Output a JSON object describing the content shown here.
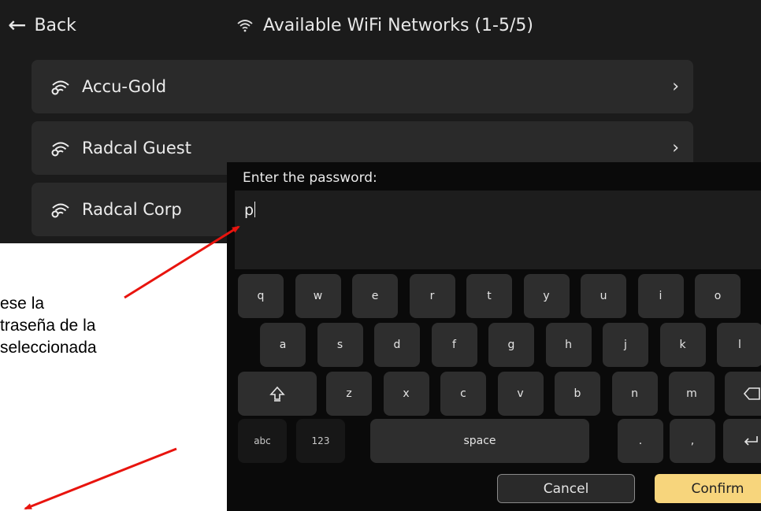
{
  "header": {
    "back_label": "Back",
    "title": "Available WiFi Networks (1-5/5)"
  },
  "networks": [
    {
      "name": "Accu-Gold"
    },
    {
      "name": "Radcal Guest"
    },
    {
      "name": "Radcal Corp"
    }
  ],
  "annotation": {
    "lines": [
      "ese la",
      "traseña de la",
      "seleccionada"
    ],
    "arrow_color": "#e8140e"
  },
  "password_dialog": {
    "prompt": "Enter the password:",
    "value": "p",
    "cancel_label": "Cancel",
    "confirm_label": "Confirm"
  },
  "keyboard": {
    "row1": [
      "q",
      "w",
      "e",
      "r",
      "t",
      "y",
      "u",
      "i",
      "o"
    ],
    "row2": [
      "a",
      "s",
      "d",
      "f",
      "g",
      "h",
      "j",
      "k",
      "l"
    ],
    "row3": [
      "z",
      "x",
      "c",
      "v",
      "b",
      "n",
      "m"
    ],
    "abc_label": "abc",
    "num_label": "123",
    "space_label": "space",
    "period_label": ".",
    "comma_label": ","
  },
  "colors": {
    "panel_bg": "#1b1b1b",
    "item_bg": "#2a2a2a",
    "key_bg": "#2e2e2e",
    "confirm_bg": "#f7d57c"
  }
}
